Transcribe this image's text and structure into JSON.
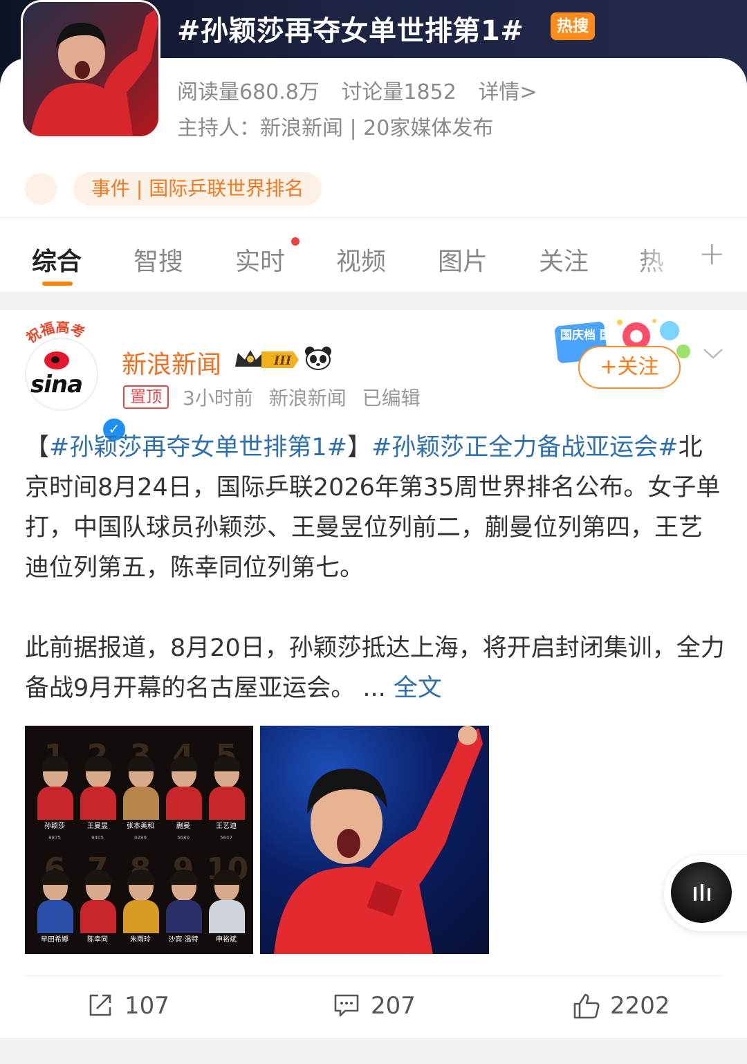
{
  "topic": {
    "title": "#孙颖莎再夺女单世排第1#",
    "hot_badge": "热搜",
    "reads": "阅读量680.8万",
    "discussions": "讨论量1852",
    "details_link": "详情>",
    "host": "主持人：新浪新闻 | 20家媒体发布",
    "tag": "事件 | 国际乒联世界排名"
  },
  "tabs": {
    "items": [
      "综合",
      "智搜",
      "实时",
      "视频",
      "图片",
      "关注",
      "热"
    ],
    "active": "综合",
    "add": "+"
  },
  "post": {
    "avatar_banner": "祝福高考",
    "author": "新浪新闻",
    "rank_badge": "III",
    "pinned": "置顶",
    "time": "3小时前",
    "source": "新浪新闻",
    "edited": "已编辑",
    "deco_text": "国庆档 国观影",
    "follow": "+关注",
    "text": {
      "lb": "【",
      "hashtag1": "#孙颖莎再夺女单世排第1#",
      "rb": "】",
      "hashtag2": "#孙颖莎正全力备战亚运会#",
      "para1": "北京时间8月24日，国际乒联2026年第35周世界排名公布。女子单打，中国队球员孙颖莎、王曼昱位列前二，蒯曼位列第四，王艺迪位列第五，陈幸同位列第七。",
      "para2": "此前据报道，8月20日，孙颖莎抵达上海，将开启封闭集训，全力备战9月开幕的名古屋亚运会。",
      "ellipsis": " ... ",
      "fulltext": "全文"
    },
    "ranking_image": {
      "top": [
        {
          "num": "1",
          "name": "孙颖莎",
          "score": "9875",
          "color": "#c8262a"
        },
        {
          "num": "2",
          "name": "王曼昱",
          "score": "9405",
          "color": "#c8262a"
        },
        {
          "num": "3",
          "name": "张本美和",
          "score": "0289",
          "color": "#b8864a"
        },
        {
          "num": "4",
          "name": "蒯曼",
          "score": "5680",
          "color": "#c8262a"
        },
        {
          "num": "5",
          "name": "王艺迪",
          "score": "5647",
          "color": "#c8262a"
        }
      ],
      "bottom": [
        {
          "num": "6",
          "name": "早田希娜",
          "score": "",
          "color": "#2a4fa8"
        },
        {
          "num": "7",
          "name": "陈幸同",
          "score": "",
          "color": "#c8262a"
        },
        {
          "num": "8",
          "name": "朱雨玲",
          "score": "",
          "color": "#d99a22"
        },
        {
          "num": "9",
          "name": "沙宾·温特",
          "score": "",
          "color": "#2a2f6a"
        },
        {
          "num": "10",
          "name": "申裕斌",
          "score": "",
          "color": "#cfd4dc"
        }
      ]
    },
    "actions": {
      "shares": "107",
      "comments": "207",
      "likes": "2202"
    }
  },
  "colors": {
    "accent": "#ff8200",
    "link": "#2f6fae",
    "author": "#f26d1d",
    "hot": "#ff8c1a"
  }
}
